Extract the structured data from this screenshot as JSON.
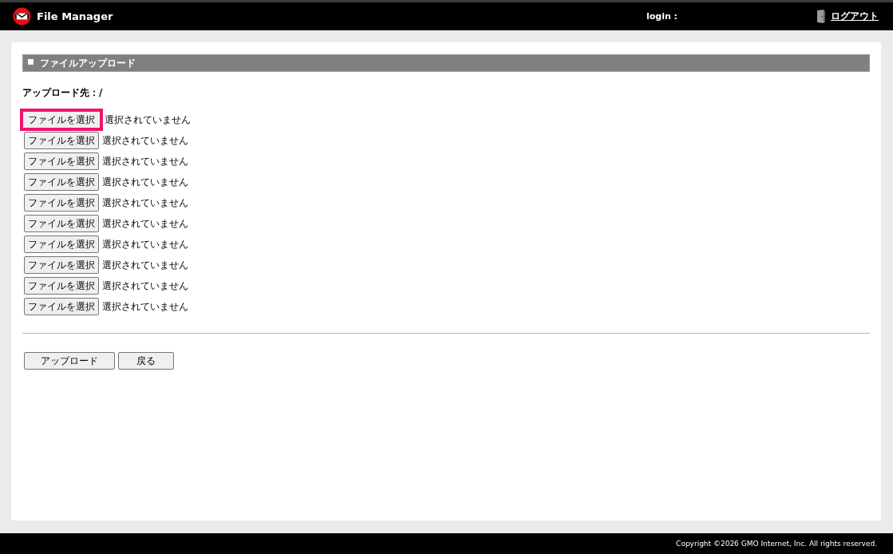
{
  "header": {
    "title": "File Manager",
    "login_label": "login :",
    "logout_link": "ログアウト"
  },
  "section": {
    "title": "ファイルアップロード",
    "destination_label": "アップロード先：/",
    "file_inputs": [
      {
        "button": "ファイルを選択",
        "status": "選択されていません",
        "highlighted": true
      },
      {
        "button": "ファイルを選択",
        "status": "選択されていません",
        "highlighted": false
      },
      {
        "button": "ファイルを選択",
        "status": "選択されていません",
        "highlighted": false
      },
      {
        "button": "ファイルを選択",
        "status": "選択されていません",
        "highlighted": false
      },
      {
        "button": "ファイルを選択",
        "status": "選択されていません",
        "highlighted": false
      },
      {
        "button": "ファイルを選択",
        "status": "選択されていません",
        "highlighted": false
      },
      {
        "button": "ファイルを選択",
        "status": "選択されていません",
        "highlighted": false
      },
      {
        "button": "ファイルを選択",
        "status": "選択されていません",
        "highlighted": false
      },
      {
        "button": "ファイルを選択",
        "status": "選択されていません",
        "highlighted": false
      },
      {
        "button": "ファイルを選択",
        "status": "選択されていません",
        "highlighted": false
      }
    ],
    "actions": [
      "アップロード",
      "戻る"
    ]
  },
  "footer": {
    "copyright": "Copyright ©2026 GMO Internet, Inc. All rights reserved."
  }
}
